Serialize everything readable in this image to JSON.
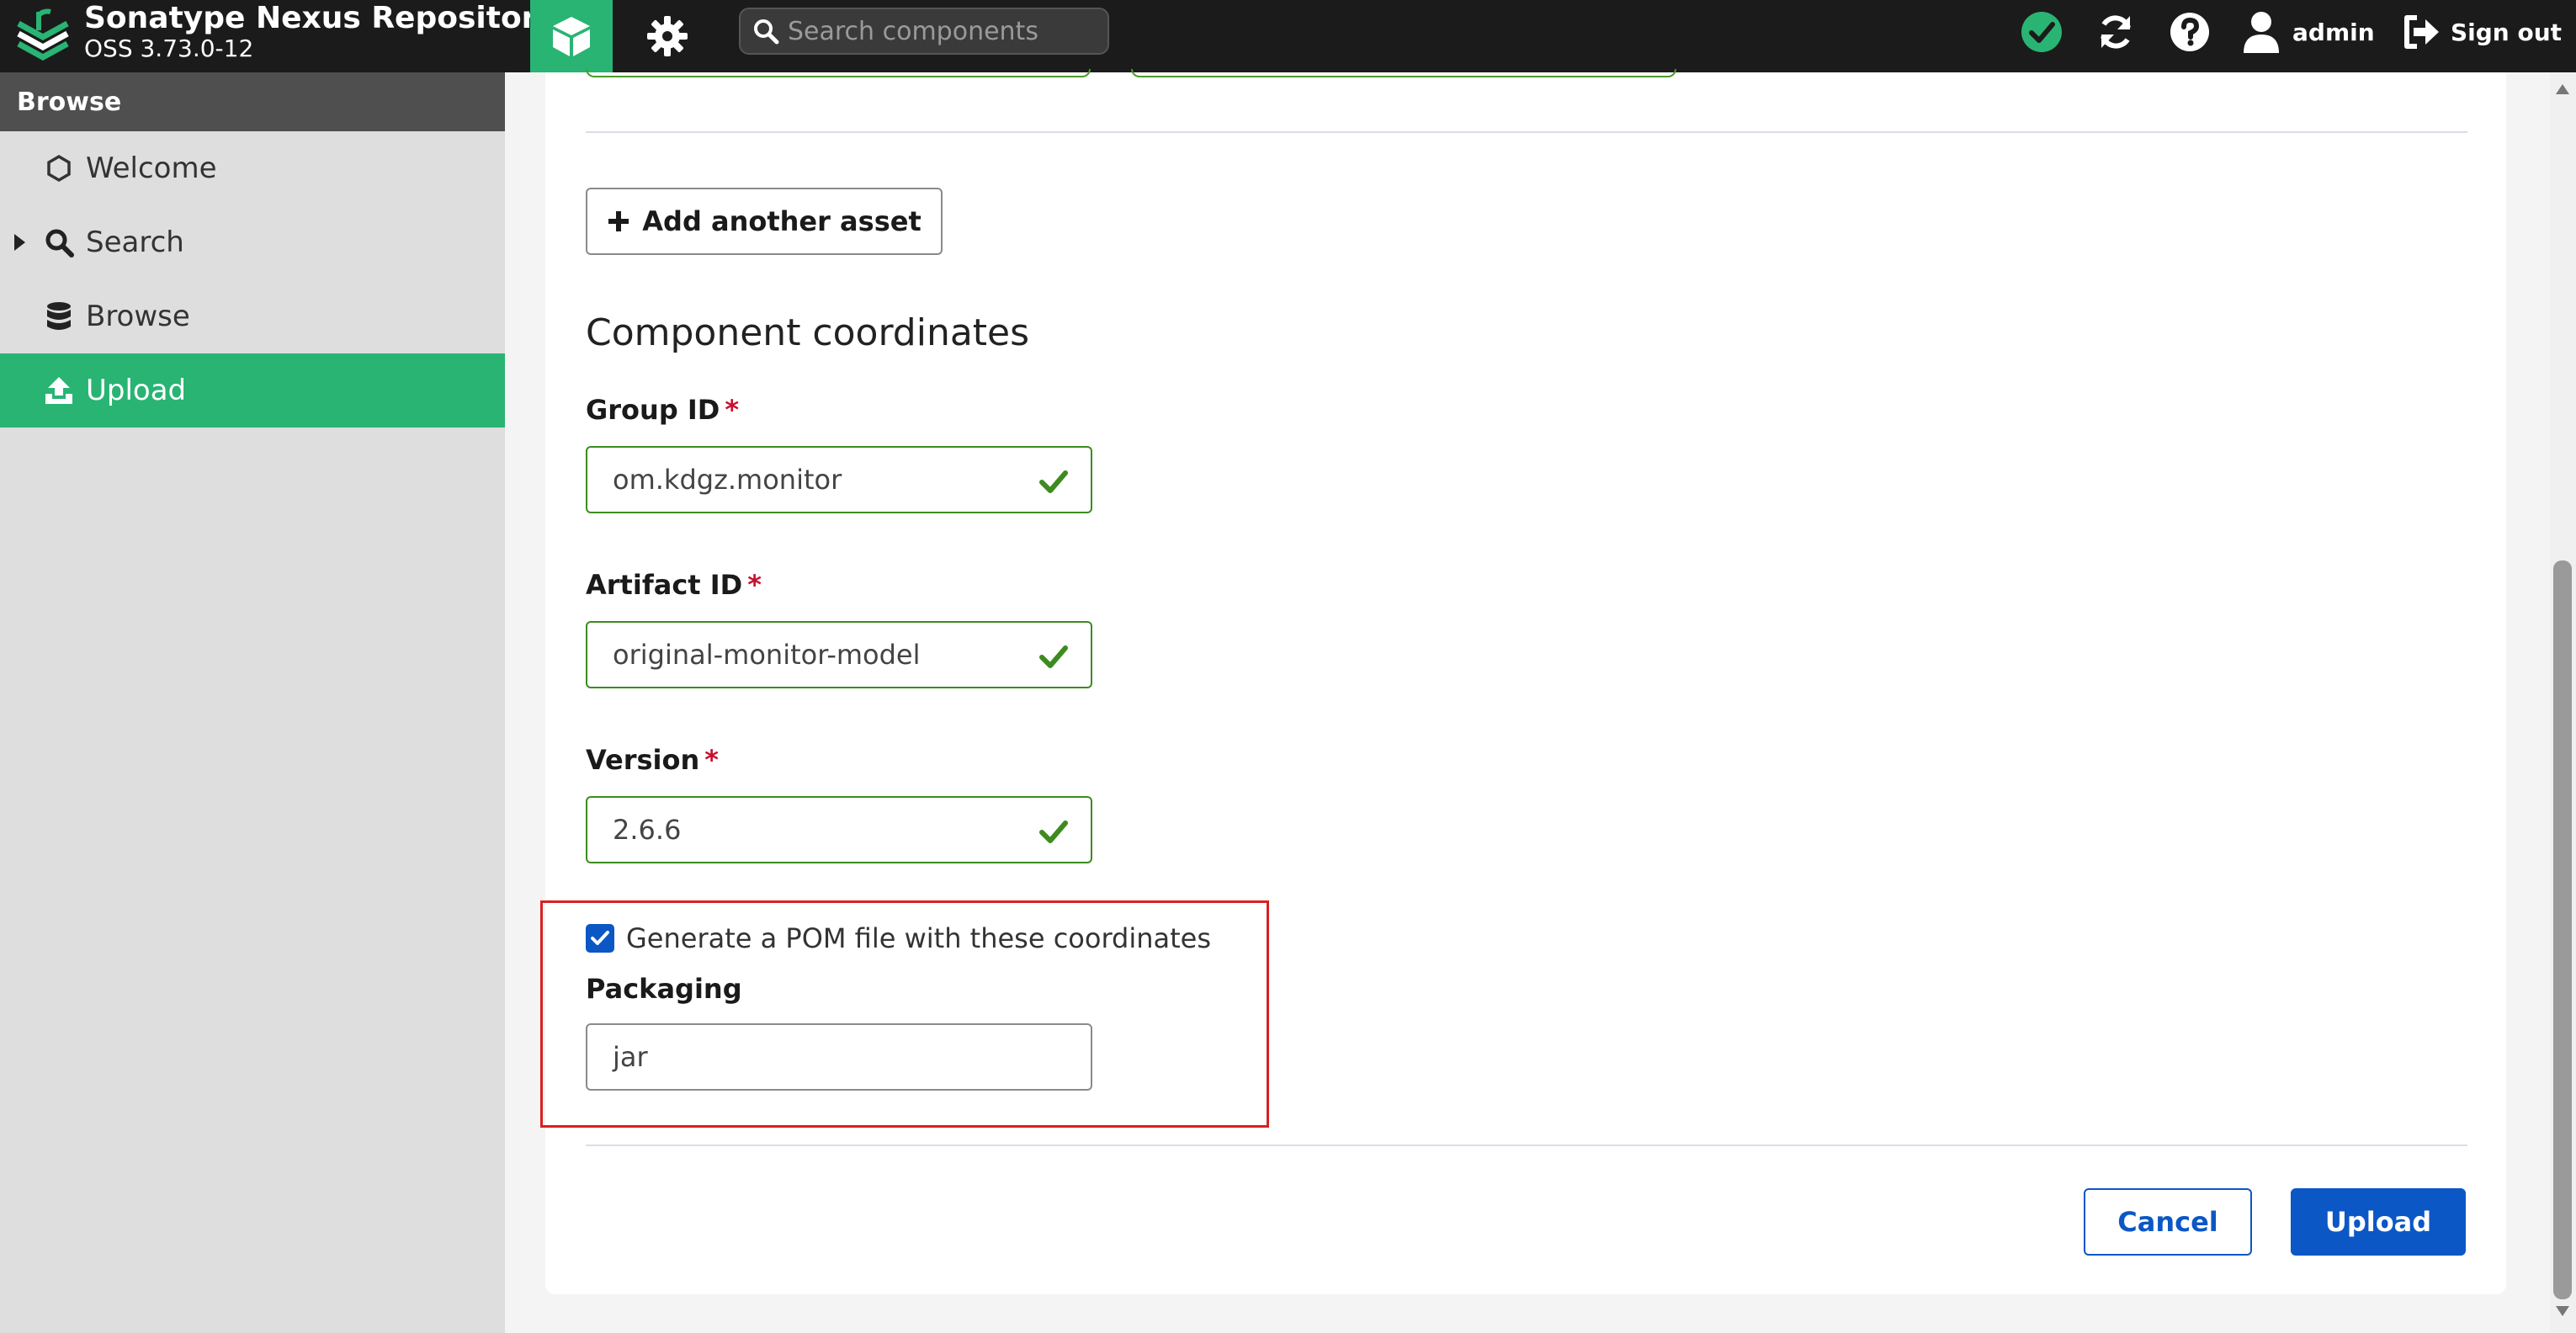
{
  "header": {
    "brand_title": "Sonatype Nexus Repository",
    "brand_version": "OSS 3.73.0-12",
    "search_placeholder": "Search components",
    "user_name": "admin",
    "signout_label": "Sign out",
    "icons": [
      "nexus-logo-icon",
      "cube-icon",
      "gear-icon",
      "search-icon",
      "health-check-icon",
      "refresh-icon",
      "help-icon",
      "user-icon",
      "sign-out-icon"
    ]
  },
  "sidebar": {
    "header": "Browse",
    "items": [
      {
        "label": "Welcome",
        "icon": "hexagon-icon"
      },
      {
        "label": "Search",
        "icon": "search-icon"
      },
      {
        "label": "Browse",
        "icon": "database-icon"
      },
      {
        "label": "Upload",
        "icon": "upload-icon",
        "active": true
      }
    ]
  },
  "form": {
    "add_asset_label": "Add another asset",
    "section_title": "Component coordinates",
    "required_mark": "*",
    "group_id": {
      "label": "Group ID",
      "value": "om.kdgz.monitor"
    },
    "artifact_id": {
      "label": "Artifact ID",
      "value": "original-monitor-model"
    },
    "version": {
      "label": "Version",
      "value": "2.6.6"
    },
    "generate_pom": {
      "label": "Generate a POM file with these coordinates",
      "checked": true
    },
    "packaging": {
      "label": "Packaging",
      "value": "jar"
    },
    "cancel_label": "Cancel",
    "upload_label": "Upload"
  },
  "colors": {
    "accent_green": "#29b473",
    "primary_blue": "#0b57c5",
    "valid_green": "#3d8b1f",
    "required_red": "#c8102e",
    "highlight_red": "#d92020"
  }
}
